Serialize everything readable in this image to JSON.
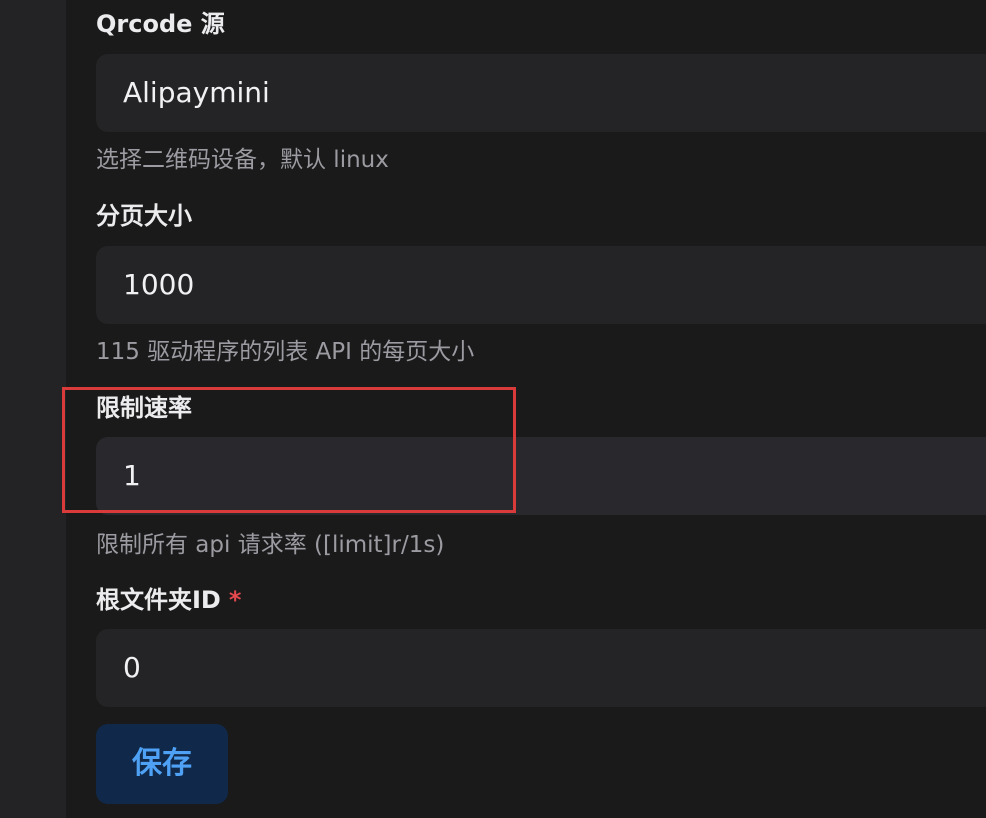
{
  "fields": {
    "qrcode_source": {
      "label": "Qrcode 源",
      "value": "Alipaymini",
      "hint": "选择二维码设备，默认 linux"
    },
    "page_size": {
      "label": "分页大小",
      "value": "1000",
      "hint": "115 驱动程序的列表 API 的每页大小"
    },
    "rate_limit": {
      "label": "限制速率",
      "value": "1",
      "hint": "限制所有 api 请求率 ([limit]r/1s)"
    },
    "root_folder_id": {
      "label": "根文件夹ID",
      "required_mark": "*",
      "value": "0"
    }
  },
  "actions": {
    "save_label": "保存"
  },
  "colors": {
    "background": "#1a1a1b",
    "input_background": "#242426",
    "highlight_border": "#d93b3b",
    "required_asterisk": "#e5484d",
    "save_button_text": "#4ea1f5",
    "save_button_background": "#10294a"
  }
}
